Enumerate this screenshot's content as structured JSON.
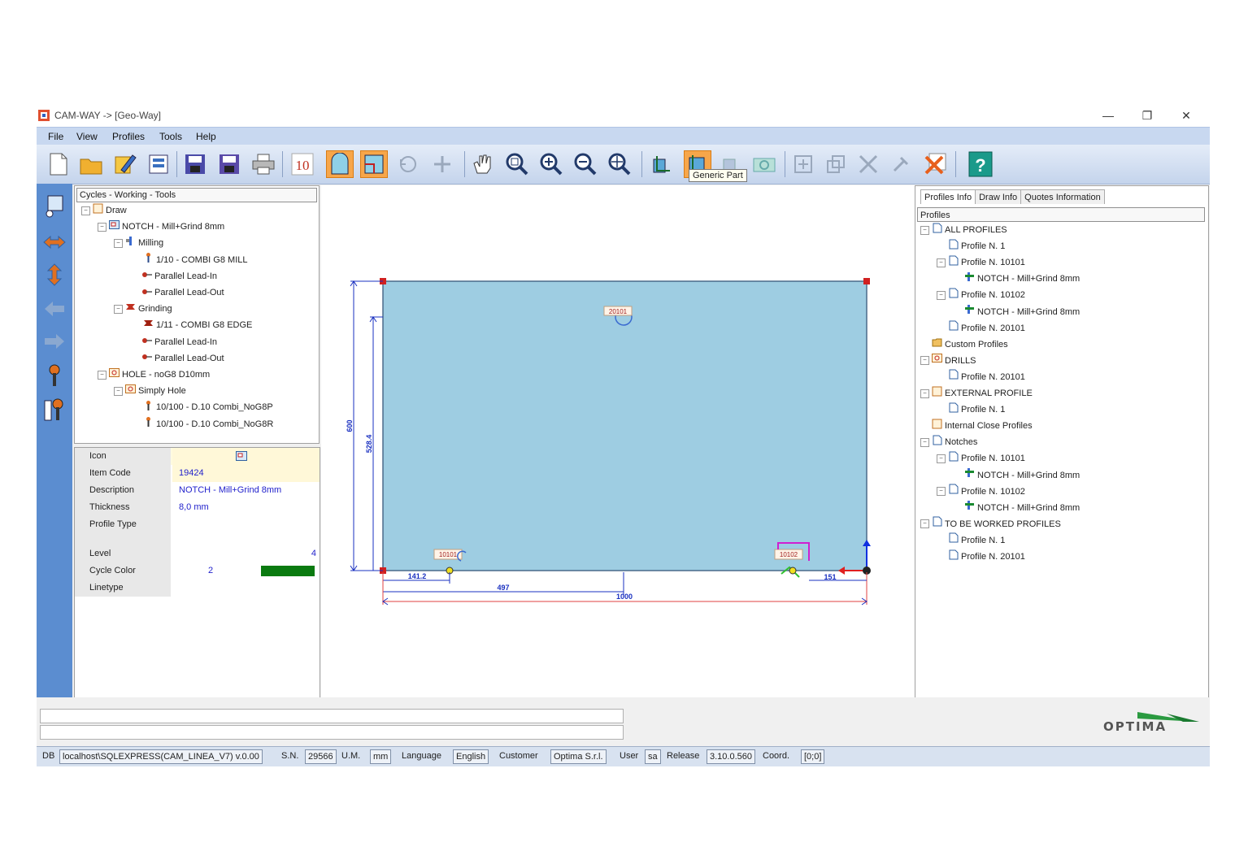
{
  "window": {
    "title": "CAM-WAY -> [Geo-Way]",
    "minimize": "—",
    "maximize": "❐",
    "close": "✕"
  },
  "menu": [
    "File",
    "View",
    "Profiles",
    "Tools",
    "Help"
  ],
  "toolbar": {
    "number_label": "10",
    "tooltip": "Generic Part"
  },
  "cycles_panel": {
    "header": "Cycles - Working - Tools",
    "tree": [
      {
        "label": "Draw",
        "icon": "draw-icon"
      },
      {
        "label": "NOTCH - Mill+Grind 8mm",
        "icon": "notch-icon"
      },
      {
        "label": "Milling",
        "icon": "milling-icon"
      },
      {
        "label": "1/10 - COMBI G8 MILL",
        "icon": "tool-icon"
      },
      {
        "label": "Parallel Lead-In",
        "icon": "lead-icon"
      },
      {
        "label": "Parallel Lead-Out",
        "icon": "lead-icon"
      },
      {
        "label": "Grinding",
        "icon": "grinding-icon"
      },
      {
        "label": "1/11 - COMBI G8 EDGE",
        "icon": "grind-tool-icon"
      },
      {
        "label": "Parallel Lead-In",
        "icon": "lead-icon"
      },
      {
        "label": "Parallel Lead-Out",
        "icon": "lead-icon"
      },
      {
        "label": "HOLE - noG8 D10mm",
        "icon": "hole-icon"
      },
      {
        "label": "Simply Hole",
        "icon": "hole-icon"
      },
      {
        "label": "10/100 - D.10 Combi_NoG8P",
        "icon": "drill-icon"
      },
      {
        "label": "10/100 - D.10 Combi_NoG8R",
        "icon": "drill-icon"
      }
    ]
  },
  "properties": {
    "rows": [
      {
        "key": "Icon",
        "value": ""
      },
      {
        "key": "Item Code",
        "value": "19424"
      },
      {
        "key": "Description",
        "value": "NOTCH - Mill+Grind 8mm"
      },
      {
        "key": "Thickness",
        "value": "8,0 mm"
      },
      {
        "key": "Profile Type",
        "value": ""
      },
      {
        "key": "Level",
        "value": "4"
      },
      {
        "key": "Cycle Color",
        "value": "2"
      },
      {
        "key": "Linetype",
        "value": ""
      }
    ],
    "cycle_color_swatch": "#0a7a10"
  },
  "drawing": {
    "part_fill": "#9ecde2",
    "hole_label": "20101",
    "notch_left_label": "10101",
    "notch_right_label": "10102",
    "dim_height_outer": "600",
    "dim_height_inner": "528.4",
    "dim_left_offset": "141.2",
    "dim_mid": "497",
    "dim_width": "1000",
    "dim_right_notch": "151"
  },
  "right_panel": {
    "tabs": [
      "Profiles Info",
      "Draw Info",
      "Quotes Information"
    ],
    "header": "Profiles",
    "tree": [
      {
        "label": "ALL PROFILES"
      },
      {
        "label": "Profile N. 1"
      },
      {
        "label": "Profile N. 10101"
      },
      {
        "label": "NOTCH - Mill+Grind 8mm"
      },
      {
        "label": "Profile N. 10102"
      },
      {
        "label": "NOTCH - Mill+Grind 8mm"
      },
      {
        "label": "Profile N. 20101"
      },
      {
        "label": "Custom Profiles"
      },
      {
        "label": "DRILLS"
      },
      {
        "label": "Profile N. 20101"
      },
      {
        "label": "EXTERNAL PROFILE"
      },
      {
        "label": "Profile N. 1"
      },
      {
        "label": "Internal Close Profiles"
      },
      {
        "label": "Notches"
      },
      {
        "label": "Profile N. 10101"
      },
      {
        "label": "NOTCH - Mill+Grind 8mm"
      },
      {
        "label": "Profile N. 10102"
      },
      {
        "label": "NOTCH - Mill+Grind 8mm"
      },
      {
        "label": "TO BE WORKED PROFILES"
      },
      {
        "label": "Profile N. 1"
      },
      {
        "label": "Profile N. 20101"
      }
    ]
  },
  "logo": "OPTIMA",
  "statusbar": {
    "db_label": "DB",
    "db_value": "localhost\\SQLEXPRESS(CAM_LINEA_V7) v.0.00",
    "sn_label": "S.N.",
    "sn_value": "29566",
    "um_label": "U.M.",
    "um_value": "mm",
    "language_label": "Language",
    "language_value": "English",
    "customer_label": "Customer",
    "customer_value": "Optima S.r.l.",
    "user_label": "User",
    "user_value": "sa",
    "release_label": "Release",
    "release_value": "3.10.0.560",
    "coord_label": "Coord.",
    "coord_value": "[0;0]"
  }
}
